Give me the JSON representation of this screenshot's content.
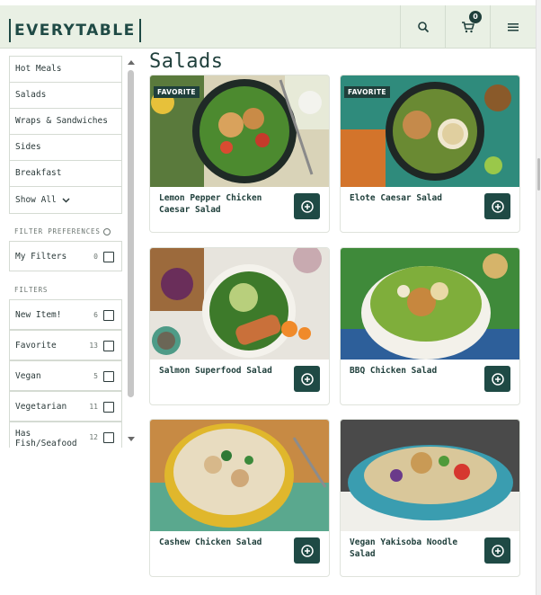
{
  "header": {
    "logo": "EVERYTABLE",
    "cart_count": "0"
  },
  "page_title": "Salads",
  "sidebar": {
    "categories": [
      "Hot Meals",
      "Salads",
      "Wraps & Sandwiches",
      "Sides",
      "Breakfast"
    ],
    "show_all": "Show All",
    "filter_preferences_label": "FILTER PREFERENCES",
    "my_filters": {
      "label": "My Filters",
      "count": "0"
    },
    "filters_label": "FILTERS",
    "filters": [
      {
        "label": "New Item!",
        "count": "6"
      },
      {
        "label": "Favorite",
        "count": "13"
      },
      {
        "label": "Vegan",
        "count": "5"
      },
      {
        "label": "Vegetarian",
        "count": "11"
      },
      {
        "label": "Has Fish/Seafood",
        "count": "12"
      }
    ]
  },
  "cards": [
    {
      "name": "Lemon Pepper Chicken Caesar Salad",
      "tag": "FAVORITE"
    },
    {
      "name": "Elote Caesar Salad",
      "tag": "FAVORITE"
    },
    {
      "name": "Salmon Superfood Salad",
      "tag": ""
    },
    {
      "name": "BBQ Chicken Salad",
      "tag": ""
    },
    {
      "name": "Cashew Chicken Salad",
      "tag": ""
    },
    {
      "name": "Vegan Yakisoba Noodle Salad",
      "tag": ""
    }
  ],
  "colors": {
    "brand": "#1f4a45",
    "header_bg": "#e9f0e4"
  },
  "icons": {
    "search": "search-icon",
    "cart": "cart-icon",
    "menu": "menu-icon",
    "add": "add-circle-icon"
  }
}
